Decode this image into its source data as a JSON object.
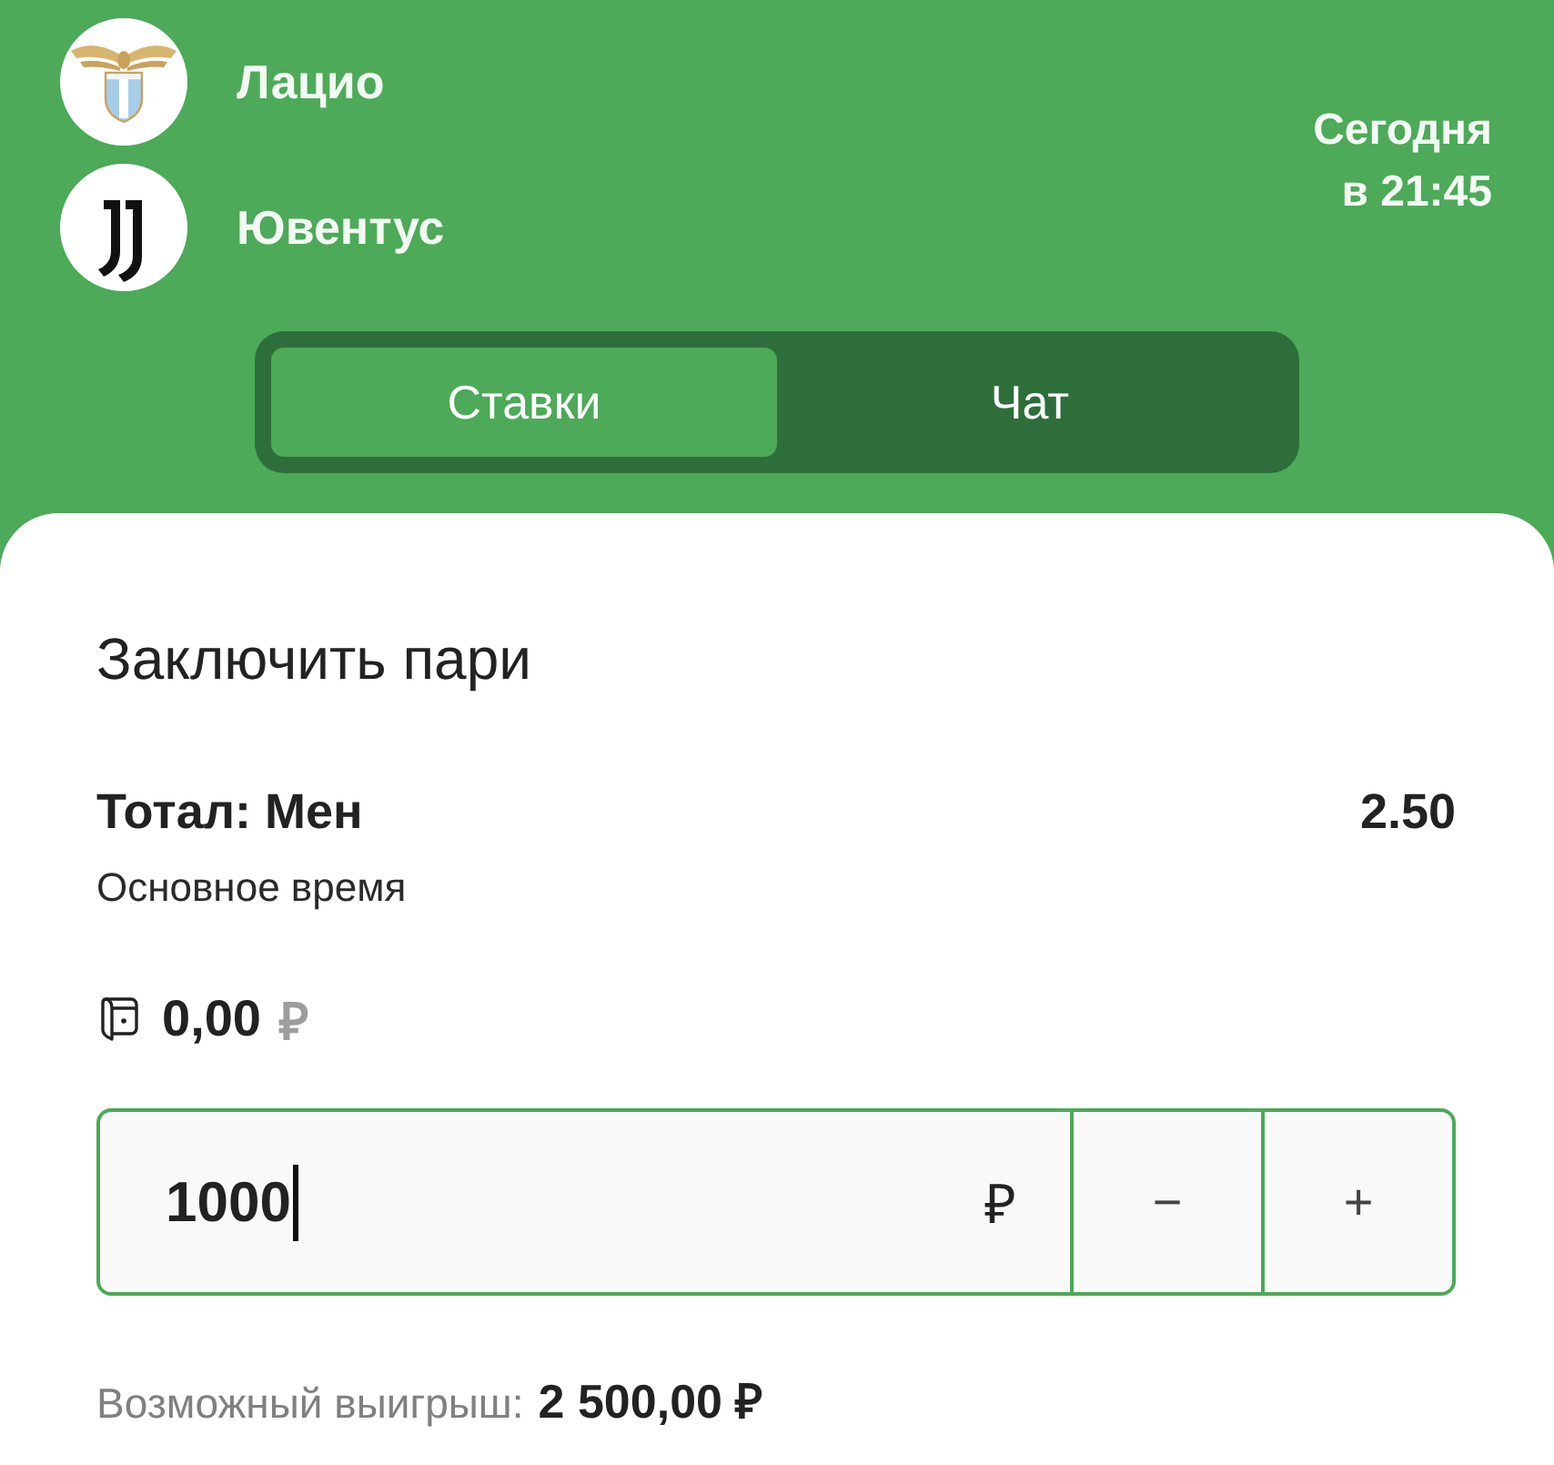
{
  "match": {
    "teams": [
      {
        "name": "Лацио",
        "kind": "eagle"
      },
      {
        "name": "Ювентус",
        "kind": "stripes"
      }
    ],
    "date": "Сегодня",
    "time": "в 21:45"
  },
  "tabs": [
    {
      "label": "Ставки",
      "selected": true
    },
    {
      "label": "Чат",
      "selected": false
    }
  ],
  "bet": {
    "title": "Заключить пари",
    "market": "Тотал: Мен",
    "odds": "2.50",
    "period": "Основное время",
    "balance": "0,00",
    "balance_currency": "₽",
    "stake": {
      "value": "1000",
      "currency": "₽",
      "focused": true
    },
    "stepper": [
      "−",
      "+"
    ],
    "payout_label": "Возможный выигрыш:",
    "payout": "2 500,00 ₽"
  }
}
